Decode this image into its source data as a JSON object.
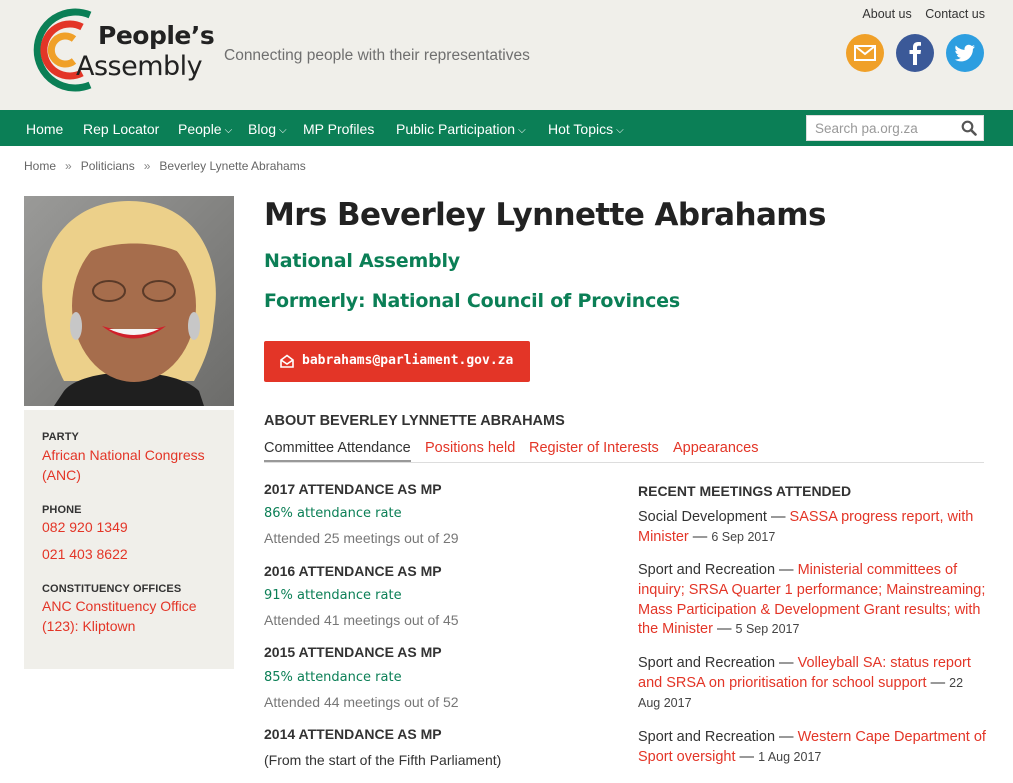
{
  "header": {
    "logo_line1": "People’s",
    "logo_line2": "Assembly",
    "tagline": "Connecting people with their representatives",
    "top_links": [
      "About us",
      "Contact us"
    ],
    "social_icons": [
      "mail-icon",
      "facebook-icon",
      "twitter-icon"
    ],
    "colors": {
      "mail": "#f0a028",
      "facebook": "#3b5998",
      "twitter": "#2d9ee0",
      "header_bg": "#f0efea"
    }
  },
  "nav": {
    "items": [
      {
        "label": "Home",
        "has_dropdown": false
      },
      {
        "label": "Rep Locator",
        "has_dropdown": false
      },
      {
        "label": "People",
        "has_dropdown": true
      },
      {
        "label": "Blog",
        "has_dropdown": true
      },
      {
        "label": "MP Profiles",
        "has_dropdown": false
      },
      {
        "label": "Public Participation",
        "has_dropdown": true
      },
      {
        "label": "Hot Topics",
        "has_dropdown": true
      }
    ],
    "search_placeholder": "Search pa.org.za",
    "color": "#0b7f56"
  },
  "breadcrumb": [
    "Home",
    "Politicians",
    "Beverley Lynette Abrahams"
  ],
  "sidebar": {
    "party_label": "PARTY",
    "party": "African National Congress (ANC)",
    "phone_label": "PHONE",
    "phones": [
      "082 920 1349",
      "021 403 8622"
    ],
    "offices_label": "CONSTITUENCY OFFICES",
    "office": "ANC Constituency Office (123): Kliptown"
  },
  "profile": {
    "name": "Mrs Beverley Lynnette Abrahams",
    "house": "National Assembly",
    "former": "Formerly: National Council of Provinces",
    "email": "babrahams@parliament.gov.za",
    "about_heading": "ABOUT BEVERLEY LYNNETTE ABRAHAMS"
  },
  "tabs": [
    "Committee Attendance",
    "Positions held",
    "Register of Interests",
    "Appearances"
  ],
  "attendance": [
    {
      "heading": "2017 ATTENDANCE AS MP",
      "rate": "86% attendance rate",
      "count": "Attended 25 meetings out of 29"
    },
    {
      "heading": "2016 ATTENDANCE AS MP",
      "rate": "91% attendance rate",
      "count": "Attended 41 meetings out of 45"
    },
    {
      "heading": "2015 ATTENDANCE AS MP",
      "rate": "85% attendance rate",
      "count": "Attended 44 meetings out of 52"
    },
    {
      "heading": "2014 ATTENDANCE AS MP",
      "count": "(From the start of the Fifth Parliament)"
    }
  ],
  "recent": {
    "heading": "RECENT MEETINGS ATTENDED",
    "meetings": [
      {
        "committee": "Social Development",
        "title": "SASSA progress report, with Minister",
        "date": "6 Sep 2017"
      },
      {
        "committee": "Sport and Recreation",
        "title": "Ministerial committees of inquiry; SRSA Quarter 1 performance; Mainstreaming; Mass Participation & Development Grant results; with the Minister",
        "date": "5 Sep 2017"
      },
      {
        "committee": "Sport and Recreation",
        "title": "Volleyball SA: status report and SRSA on prioritisation for school support",
        "date": "22 Aug 2017"
      },
      {
        "committee": "Sport and Recreation",
        "title": "Western Cape Department of Sport oversight",
        "date": "1 Aug 2017"
      }
    ]
  }
}
